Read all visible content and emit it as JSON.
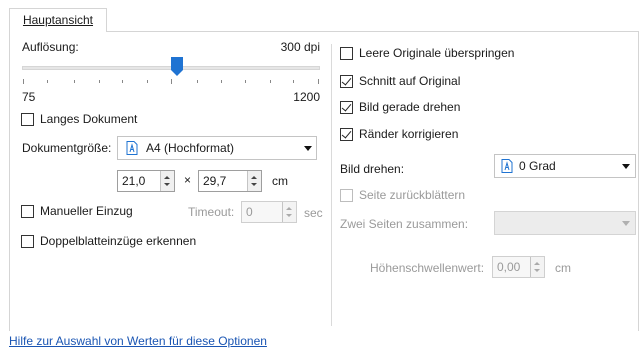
{
  "tab": {
    "label": "Hauptansicht"
  },
  "resolution": {
    "label": "Auflösung:",
    "value_text": "300 dpi",
    "min_label": "75",
    "max_label": "1200",
    "value_fraction": 0.52
  },
  "long_document": {
    "label": "Langes Dokument",
    "checked": false
  },
  "document_size": {
    "label": "Dokumentgröße:",
    "selected": "A4 (Hochformat)"
  },
  "dimensions": {
    "width": "21,0",
    "times": "×",
    "height": "29,7",
    "unit": "cm"
  },
  "manual_feed": {
    "label": "Manueller Einzug",
    "checked": false,
    "timeout_label": "Timeout:",
    "timeout_value": "0",
    "timeout_unit": "sec"
  },
  "double_feed": {
    "label": "Doppelblatteinzüge erkennen",
    "checked": false
  },
  "skip_blank": {
    "label": "Leere Originale überspringen",
    "checked": false
  },
  "crop": {
    "label": "Schnitt auf Original",
    "checked": true
  },
  "deskew": {
    "label": "Bild gerade drehen",
    "checked": true
  },
  "edges": {
    "label": "Ränder korrigieren",
    "checked": true
  },
  "rotate": {
    "label": "Bild drehen:",
    "selected": "0 Grad"
  },
  "flip_page": {
    "label": "Seite zurückblättern",
    "checked": false,
    "enabled": false
  },
  "merge_sides": {
    "label": "Zwei Seiten zusammen:",
    "selected": "",
    "enabled": false
  },
  "height_threshold": {
    "label": "Höhenschwellenwert:",
    "value": "0,00",
    "unit": "cm"
  },
  "help_link": "Hilfe zur Auswahl von Werten für diese Optionen",
  "colors": {
    "accent": "#1f73d2",
    "link": "#1a55b3"
  }
}
